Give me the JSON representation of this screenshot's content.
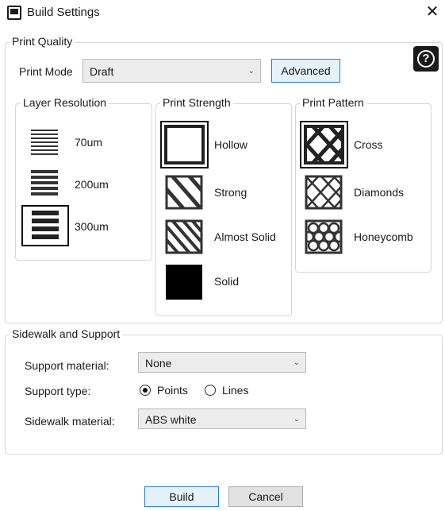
{
  "window": {
    "title": "Build Settings",
    "close_glyph": "✕",
    "icon": "window-icon"
  },
  "print_quality": {
    "legend": "Print Quality",
    "mode_label": "Print Mode",
    "mode_value": "Draft",
    "advanced_label": "Advanced",
    "help_glyph": "?",
    "layer_resolution": {
      "legend": "Layer Resolution",
      "selected": "300um",
      "options": [
        {
          "label": "70um",
          "lines": 7
        },
        {
          "label": "200um",
          "lines": 5
        },
        {
          "label": "300um",
          "lines": 4
        }
      ]
    },
    "print_strength": {
      "legend": "Print Strength",
      "selected": "Hollow",
      "options": [
        {
          "label": "Hollow"
        },
        {
          "label": "Strong"
        },
        {
          "label": "Almost Solid"
        },
        {
          "label": "Solid"
        }
      ]
    },
    "print_pattern": {
      "legend": "Print Pattern",
      "selected": "Cross",
      "options": [
        {
          "label": "Cross"
        },
        {
          "label": "Diamonds"
        },
        {
          "label": "Honeycomb"
        }
      ]
    }
  },
  "sidewalk_support": {
    "legend": "Sidewalk and Support",
    "support_material_label": "Support material:",
    "support_material_value": "None",
    "support_type_label": "Support type:",
    "support_type_options": [
      "Points",
      "Lines"
    ],
    "support_type_selected": "Points",
    "sidewalk_material_label": "Sidewalk material:",
    "sidewalk_material_value": "ABS white"
  },
  "footer": {
    "build_label": "Build",
    "cancel_label": "Cancel"
  },
  "colors": {
    "accent": "#2a7bd5",
    "thumb_dark": "#1a1a1a",
    "group_border": "#d6d6d6"
  }
}
